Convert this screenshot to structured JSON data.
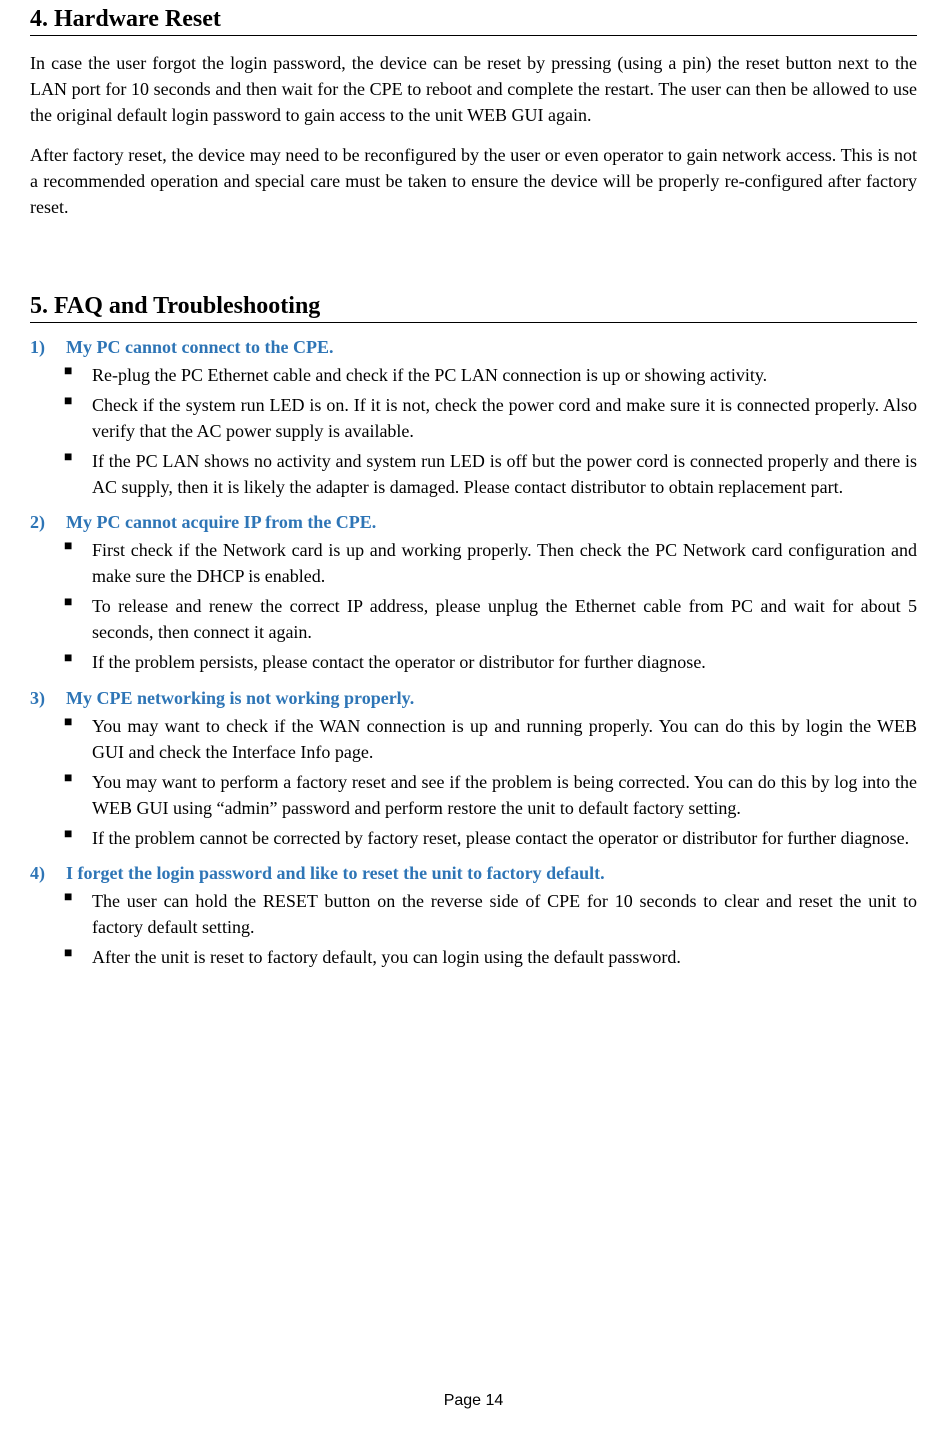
{
  "section1": {
    "heading": "4.    Hardware Reset",
    "para1": "In case the user forgot the login password, the device can be reset by pressing (using a pin) the reset button next to the LAN port for 10 seconds and then wait for the CPE to reboot and complete the restart. The user can then be allowed to use the original default login password to gain access to the unit WEB GUI again.",
    "para2": "After factory reset, the device may need to be reconfigured by the user or even operator to gain network access. This is not a recommended operation and special care must be taken to ensure the device will be properly re-configured after factory reset."
  },
  "section2": {
    "heading": "5.    FAQ and Troubleshooting",
    "faq": [
      {
        "num": "1)",
        "title": "My PC cannot connect to the CPE.",
        "bullets": [
          "Re-plug the PC Ethernet cable and check if the PC LAN connection is up or showing activity.",
          "Check if the system run LED is on. If it is not, check the power cord and make sure it is connected properly. Also verify that the AC power supply is available.",
          "If the PC LAN shows no activity and system run LED is off but the power cord is connected properly and there is AC supply, then it is likely the adapter is damaged. Please contact distributor to obtain replacement part."
        ]
      },
      {
        "num": "2)",
        "title": "My PC cannot acquire IP from the CPE.",
        "bullets": [
          "First check if the Network card is up and working properly. Then check the PC Network card configuration and make sure the DHCP is enabled.",
          "To release and renew the correct IP address, please unplug the Ethernet cable from PC and wait for about 5 seconds, then connect it again.",
          "If the problem persists, please contact the operator or distributor for further diagnose."
        ]
      },
      {
        "num": "3)",
        "title": "My CPE networking is not working properly.",
        "bullets": [
          "You may want to check if the WAN connection is up and running properly. You can do this by login the WEB GUI and check the Interface Info page.",
          "You may want to perform a factory reset and see if the problem is being corrected. You can do this by log into the WEB GUI using “admin” password and perform restore the unit to default factory setting.",
          "If the problem cannot be corrected by factory reset, please contact the operator or distributor for further diagnose."
        ]
      },
      {
        "num": "4)",
        "title": "I forget the login password and like to reset the unit to factory default.",
        "bullets": [
          "The user can hold the RESET button on the reverse side of CPE for 10 seconds to clear and reset the unit to factory default setting.",
          "After the unit is reset to factory default, you can login using the default password."
        ]
      }
    ]
  },
  "footer": "Page 14"
}
